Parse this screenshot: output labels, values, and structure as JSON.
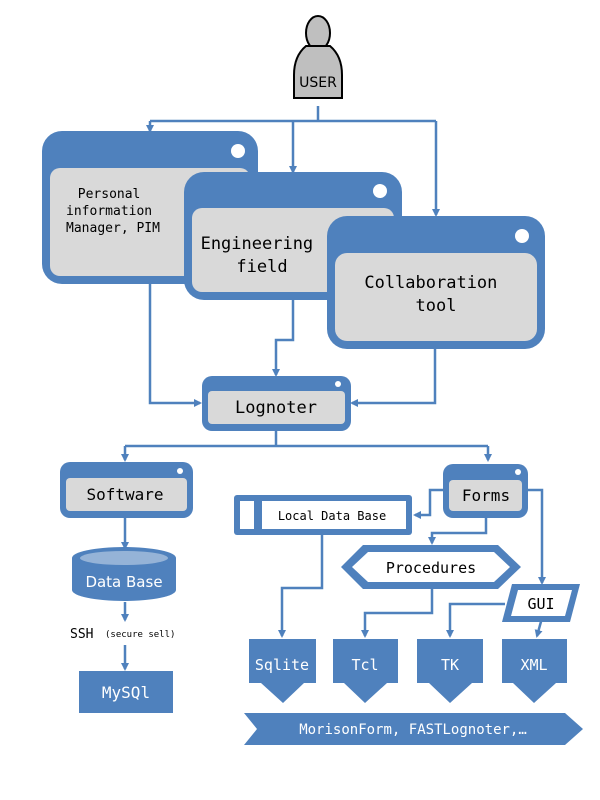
{
  "colors": {
    "primary": "#4f81bd",
    "window_body": "#d9d9d9",
    "user_fill": "#bfbfbf",
    "cylinder_top": "#95b3d7",
    "text_dark": "#000000",
    "text_light": "#ffffff"
  },
  "nodes": {
    "user": "USER",
    "pim": [
      "Personal",
      "information",
      "Manager, PIM"
    ],
    "engineering": [
      "Engineering",
      "field"
    ],
    "collaboration": [
      "Collaboration",
      "tool"
    ],
    "lognoter": "Lognoter",
    "software": "Software",
    "database": "Data Base",
    "ssh": "SSH",
    "ssh_note": "(secure sell)",
    "mysql": "MySQl",
    "forms": "Forms",
    "local_db": "Local Data Base",
    "procedures": "Procedures",
    "gui": "GUI",
    "sqlite": "Sqlite",
    "tcl": "Tcl",
    "tk": "TK",
    "xml": "XML",
    "outputs": "MorisonForm, FASTLognoter,…"
  }
}
